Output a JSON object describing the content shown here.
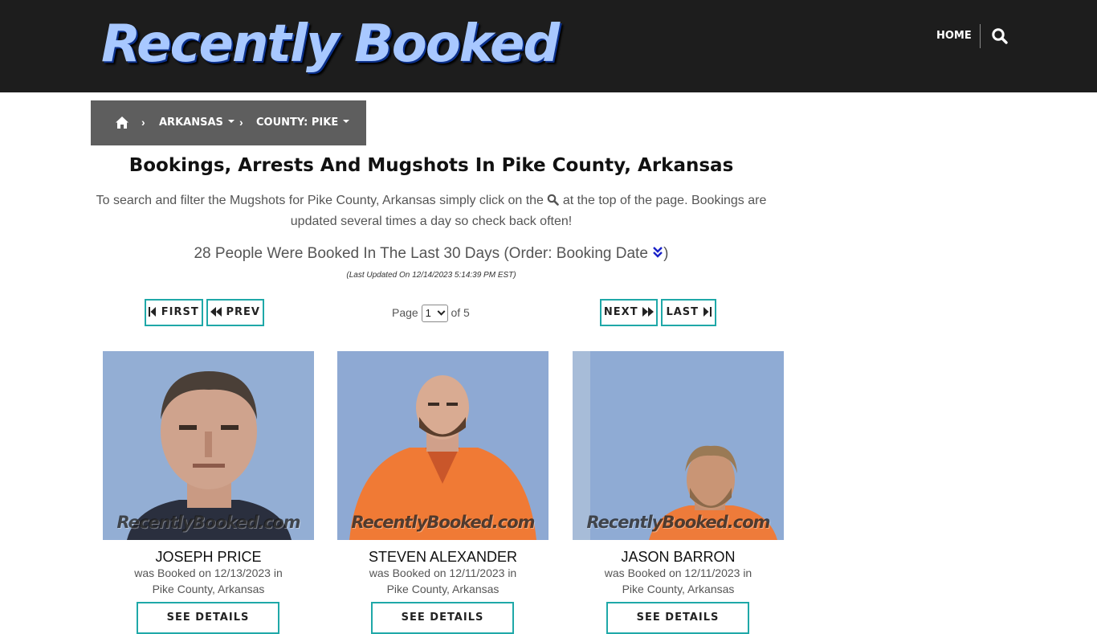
{
  "header": {
    "logo_text": "Recently Booked",
    "nav_home": "HOME",
    "search_icon": "search-icon"
  },
  "breadcrumb": {
    "home_icon": "home-icon",
    "separator": "›",
    "state": "ARKANSAS",
    "county": "COUNTY: PIKE"
  },
  "main": {
    "title": "Bookings, Arrests And Mugshots In Pike County, Arkansas",
    "intro_before": "To search and filter the Mugshots for Pike County, Arkansas simply click on the",
    "intro_after": "at the top of the page. Bookings are updated several times a day so check back often!",
    "count_text": "28 People Were Booked In The Last 30 Days (Order: Booking Date",
    "count_close": ")",
    "order_icon": "double-chevron-down-icon",
    "last_updated": "(Last Updated On 12/14/2023 5:14:39 PM EST)"
  },
  "pager": {
    "first": "FIRST",
    "prev": "PREV",
    "next": "NEXT",
    "last": "LAST",
    "page_label": "Page",
    "current_page": "1",
    "of_label": "of 5"
  },
  "colors": {
    "header_bg": "#1d1d1d",
    "breadcrumb_bg": "#5e5e5e",
    "accent_border": "#1fa8a8",
    "order_icon": "#1a22c8"
  },
  "cards": [
    {
      "name": "JOSEPH PRICE",
      "booked_line": "was Booked on 12/13/2023 in",
      "location": "Pike County, Arkansas",
      "watermark": "RecentlyBooked.com",
      "details_label": "SEE DETAILS"
    },
    {
      "name": "STEVEN ALEXANDER",
      "booked_line": "was Booked on 12/11/2023 in",
      "location": "Pike County, Arkansas",
      "watermark": "RecentlyBooked.com",
      "details_label": "SEE DETAILS"
    },
    {
      "name": "JASON BARRON",
      "booked_line": "was Booked on 12/11/2023 in",
      "location": "Pike County, Arkansas",
      "watermark": "RecentlyBooked.com",
      "details_label": "SEE DETAILS"
    }
  ]
}
